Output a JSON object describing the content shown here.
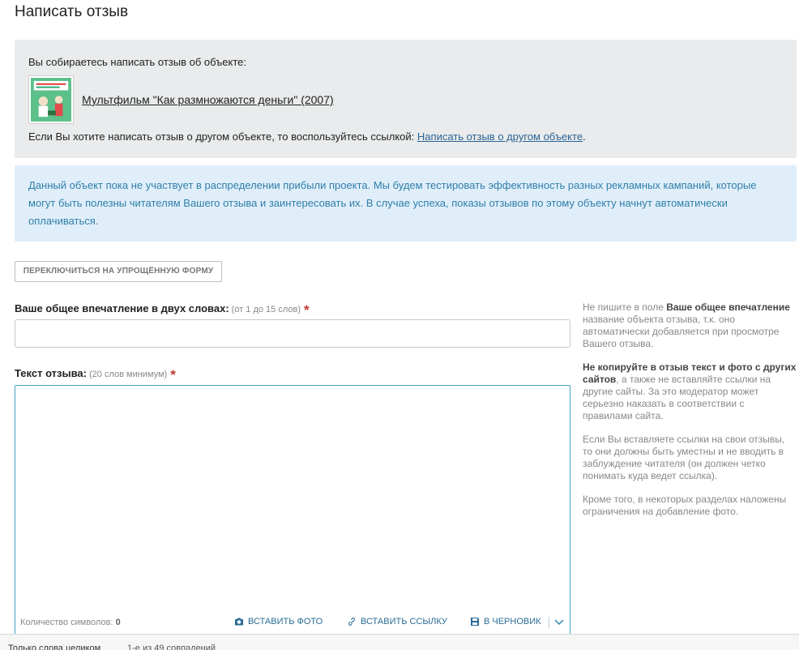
{
  "page": {
    "title": "Написать отзыв"
  },
  "object": {
    "intro": "Вы собираетесь написать отзыв об объекте:",
    "title": "Мультфильм \"Как размножаются деньги\" (2007)",
    "other_prefix": "Если Вы хотите написать отзыв о другом объекте, то воспользуйтесь ссылкой:",
    "other_link": "Написать отзыв о другом объекте",
    "other_suffix": "."
  },
  "info": {
    "text": "Данный объект пока не участвует в распределении прибыли проекта. Мы будем тестировать эффективность разных рекламных кампаний, которые могут быть полезны читателям Вашего отзыва и заинтересовать их. В случае успеха, показы отзывов по этому объекту начнут автоматически оплачиваться."
  },
  "switch_button": {
    "label": "ПЕРЕКЛЮЧИТЬСЯ НА УПРОЩЁННУЮ ФОРМУ"
  },
  "impression": {
    "label": "Ваше общее впечатление в двух словах:",
    "hint": "(от 1 до 15 слов)",
    "required": "*",
    "value": ""
  },
  "review": {
    "label": "Текст отзыва:",
    "hint": "(20 слов минимум)",
    "required": "*",
    "value": ""
  },
  "editor": {
    "char_count_label": "Количество символов:",
    "char_count_value": "0",
    "insert_photo": "ВСТАВИТЬ ФОТО",
    "insert_link": "ВСТАВИТЬ ССЫЛКУ",
    "to_draft": "В ЧЕРНОВИК"
  },
  "sidebar": {
    "p1_a": "Не пишите в поле ",
    "p1_b": "Ваше общее впечатление",
    "p1_c": " название объекта отзыва, т.к. оно автоматически добавляется при просмотре Вашего отзыва.",
    "p2_a": "Не копируйте в отзыв текст и фото с других сайтов",
    "p2_b": ", а также не вставляйте ссылки на другие сайты. За это модератор может серьезно наказать в соответствии с правилами сайта.",
    "p3": "Если Вы вставляете ссылки на свои отзывы, то они должны быть уместны и не вводить в заблуждение читателя (он должен четко понимать куда ведет ссылка).",
    "p4": "Кроме того, в некоторых разделах наложены ограничения на добавление фото."
  },
  "find_bar": {
    "whole_words": "Только слова целиком",
    "matches": "1-е из 49 совпадений"
  },
  "colors": {
    "object_bg": "#e9ebec",
    "info_bg": "#e0eefa",
    "info_text": "#2f7fa9",
    "link": "#2a6496",
    "required": "#c0392b",
    "textarea_focus": "#4aa3c9"
  }
}
